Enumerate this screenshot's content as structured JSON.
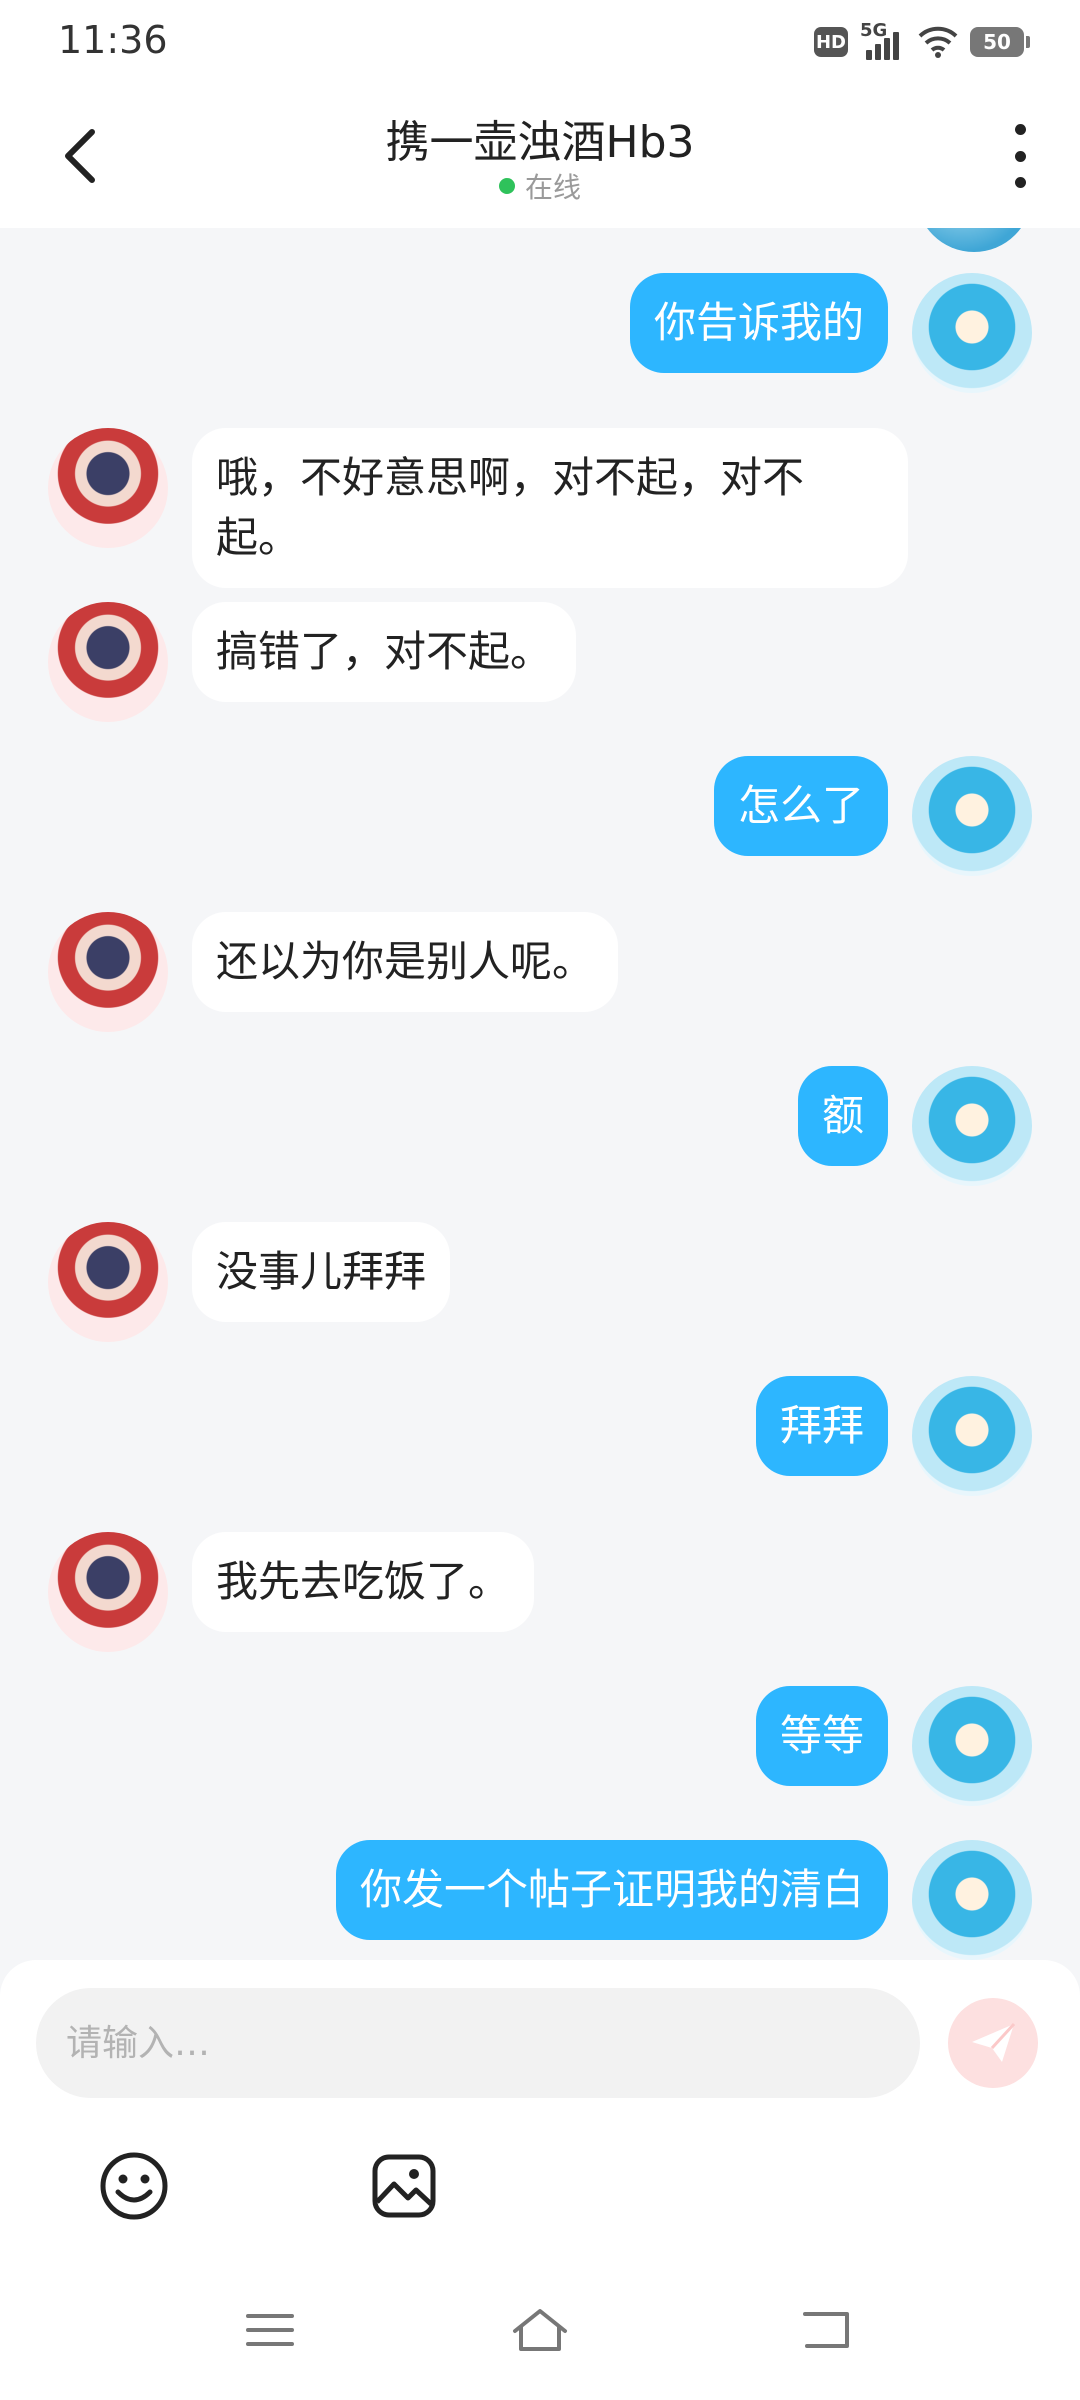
{
  "status_bar": {
    "time": "11:36",
    "hd_label": "HD",
    "network_label": "5G",
    "battery_level": "50"
  },
  "header": {
    "title": "携一壶浊酒Hb3",
    "status": "在线"
  },
  "messages": [
    {
      "side": "right",
      "text": "你告诉我的"
    },
    {
      "side": "left",
      "text": "哦，不好意思啊，对不起，对不起。"
    },
    {
      "side": "left",
      "text": "搞错了，对不起。"
    },
    {
      "side": "right",
      "text": "怎么了"
    },
    {
      "side": "left",
      "text": "还以为你是别人呢。"
    },
    {
      "side": "right",
      "text": "额"
    },
    {
      "side": "left",
      "text": "没事儿拜拜"
    },
    {
      "side": "right",
      "text": "拜拜"
    },
    {
      "side": "left",
      "text": "我先去吃饭了。"
    },
    {
      "side": "right",
      "text": "等等"
    },
    {
      "side": "right",
      "text": "你发一个帖子证明我的清白"
    }
  ],
  "input": {
    "placeholder": "请输入…",
    "value": ""
  },
  "colors": {
    "outgoing_bubble": "#2db6ff",
    "incoming_bubble": "#ffffff",
    "online_dot": "#2fc25b",
    "send_button": "#fde0e0"
  }
}
